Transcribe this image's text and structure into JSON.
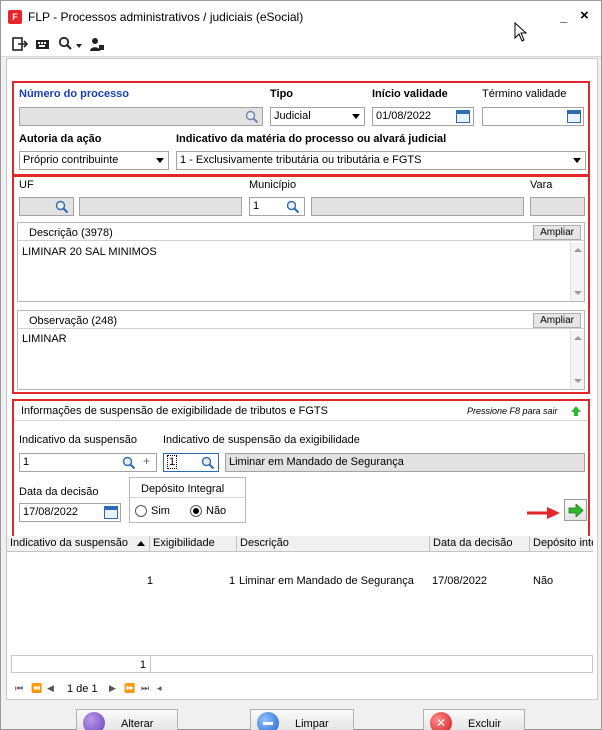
{
  "window": {
    "title": "FLP - Processos administrativos / judiciais (eSocial)",
    "minimize": "_",
    "close": "×"
  },
  "processo": {
    "numero_label": "Número do processo",
    "numero_value": "",
    "tipo_label": "Tipo",
    "tipo_value": "Judicial",
    "inicio_label": "Início validade",
    "inicio_value": "01/08/2022",
    "termino_label": "Término validade",
    "termino_value": "",
    "autoria_label": "Autoria da ação",
    "autoria_value": "Próprio contribuinte",
    "indicativo_label": "Indicativo da matéria do processo ou alvará judicial",
    "indicativo_value": "1 - Exclusivamente tributária ou tributária e FGTS"
  },
  "local": {
    "uf_label": "UF",
    "uf_value": "",
    "uf_name": "",
    "municipio_label": "Município",
    "municipio_value": "1",
    "municipio_name": "",
    "vara_label": "Vara",
    "vara_value": ""
  },
  "descricao": {
    "label": "Descrição (3978)",
    "ampliar": "Ampliar",
    "text": "LIMINAR 20 SAL MINIMOS"
  },
  "observacao": {
    "label": "Observação (248)",
    "ampliar": "Ampliar",
    "text": "LIMINAR"
  },
  "suspensao": {
    "section_title": "Informações de suspensão de exigibilidade de tributos e FGTS",
    "hint": "Pressione F8 para sair",
    "ind_label": "Indicativo da suspensão",
    "ind_value": "1",
    "ind_exig_label": "Indicativo de suspensão da exigibilidade",
    "ind_exig_value": "1",
    "ind_exig_desc": "Liminar em Mandado de Segurança",
    "data_label": "Data da decisão",
    "data_value": "17/08/2022",
    "deposito_label": "Depósito Integral",
    "sim_label": "Sim",
    "nao_label": "Não"
  },
  "grid": {
    "columns": [
      "Indicativo da suspensão",
      "Exigibilidade",
      "Descrição",
      "Data da decisão",
      "Depósito inte"
    ],
    "rows": [
      {
        "indicativo": "1",
        "exigibilidade": "1",
        "descricao": "Liminar em Mandado de Segurança",
        "data": "17/08/2022",
        "deposito": "Não"
      }
    ],
    "count": "1",
    "page": "1 de 1"
  },
  "actions": {
    "alterar": "Alterar",
    "limpar": "Limpar",
    "excluir": "Excluir"
  },
  "colors": {
    "highlight": "#e3262a",
    "label_blue": "#1a3fb9",
    "go_green": "#2fb82f"
  }
}
